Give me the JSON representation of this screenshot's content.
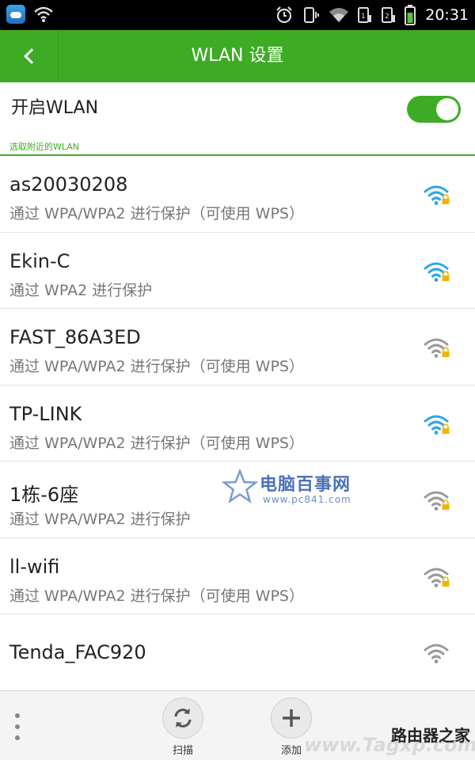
{
  "status_bar": {
    "time": "20:31",
    "icons": [
      "app-weather-icon",
      "wifi-status-icon",
      "alarm-icon",
      "vibrate-icon",
      "wifi-signal-icon",
      "sim1-icon",
      "sim2-icon",
      "battery-icon"
    ]
  },
  "header": {
    "title": "WLAN 设置",
    "back_icon": "chevron-left-icon"
  },
  "wlan_toggle": {
    "label": "开启WLAN",
    "state": "on"
  },
  "section_label": "选取附近的WLAN",
  "networks": [
    {
      "name": "as20030208",
      "security": "通过 WPA/WPA2 进行保护（可使用 WPS）",
      "signal": "strong",
      "locked": true
    },
    {
      "name": "Ekin-C",
      "security": "通过 WPA2 进行保护",
      "signal": "strong",
      "locked": true
    },
    {
      "name": "FAST_86A3ED",
      "security": "通过 WPA/WPA2 进行保护（可使用 WPS）",
      "signal": "medium",
      "locked": true
    },
    {
      "name": "TP-LINK",
      "security": "通过 WPA/WPA2 进行保护（可使用 WPS）",
      "signal": "strong",
      "locked": true
    },
    {
      "name": "1栋-6座",
      "security": "通过 WPA/WPA2 进行保护",
      "signal": "medium",
      "locked": true
    },
    {
      "name": "ll-wifi",
      "security": "通过 WPA/WPA2 进行保护（可使用 WPS）",
      "signal": "medium",
      "locked": true
    },
    {
      "name": "Tenda_FAC920",
      "security": "",
      "signal": "medium",
      "locked": false
    }
  ],
  "watermark": {
    "title": "电脑百事网",
    "url": "www.pc841.com"
  },
  "bottom_bar": {
    "scan_label": "扫描",
    "add_label": "添加",
    "watermark_text": "路由器之家",
    "watermark_sub": "www.Tagxp.com"
  },
  "colors": {
    "accent": "#3dab24",
    "signal_strong": "#29a8e8",
    "signal_medium": "#9a9a9a",
    "lock": "#f2b400"
  }
}
